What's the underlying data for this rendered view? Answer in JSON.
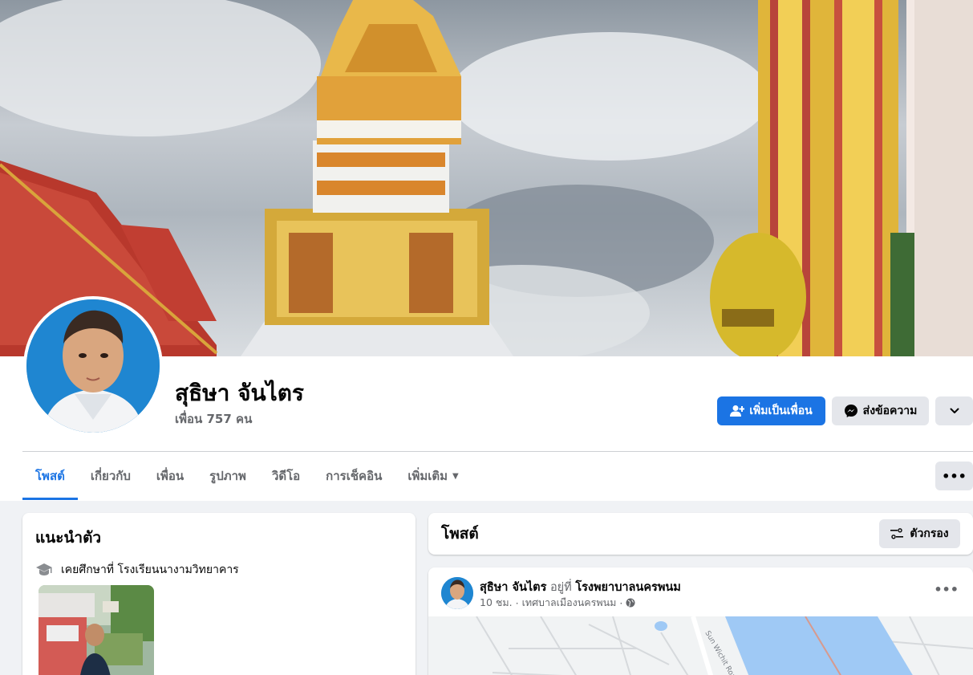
{
  "profile": {
    "name": "สุธิษา จันไตร",
    "friends": "เพื่อน 757 คน"
  },
  "actions": {
    "add_friend": "เพิ่มเป็นเพื่อน",
    "message": "ส่งข้อความ"
  },
  "tabs": [
    {
      "label": "โพสต์",
      "active": true
    },
    {
      "label": "เกี่ยวกับ",
      "active": false
    },
    {
      "label": "เพื่อน",
      "active": false
    },
    {
      "label": "รูปภาพ",
      "active": false
    },
    {
      "label": "วิดีโอ",
      "active": false
    },
    {
      "label": "การเช็คอิน",
      "active": false
    },
    {
      "label": "เพิ่มเติม",
      "active": false
    }
  ],
  "intro": {
    "title": "แนะนำตัว",
    "education": "เคยศึกษาที่ โรงเรียนนางามวิทยาคาร"
  },
  "posts": {
    "title": "โพสต์",
    "filter_label": "ตัวกรอง"
  },
  "post": {
    "author": "สุธิษา จันไตร",
    "at_text": "อยู่ที่",
    "place": "โรงพยาบาลนครพนม",
    "time": "10 ชม.",
    "location": "เทศบาลเมืองนครพนม",
    "map_road_label": "Sun Wichit Road"
  },
  "colors": {
    "primary": "#1b74e4",
    "page_bg": "#f0f2f5",
    "secondary_btn": "#e4e6eb"
  }
}
